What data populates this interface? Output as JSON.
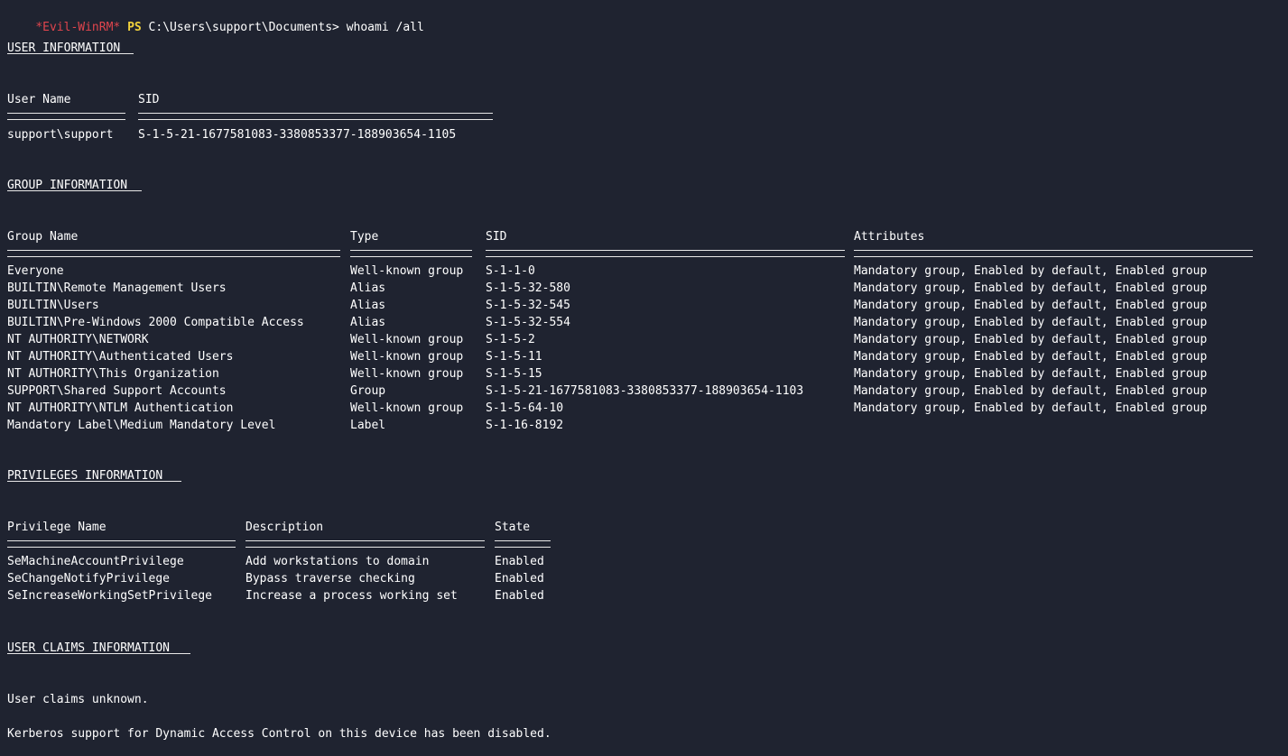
{
  "prompt": {
    "evil": "*Evil-WinRM*",
    "ps": "PS",
    "path": "C:\\Users\\support\\Documents>"
  },
  "command": "whoami /all",
  "user_info": {
    "title": "USER INFORMATION",
    "headers": [
      "User Name",
      "SID"
    ],
    "rows": [
      [
        "support\\support",
        "S-1-5-21-1677581083-3380853377-188903654-1105"
      ]
    ]
  },
  "group_info": {
    "title": "GROUP INFORMATION",
    "headers": [
      "Group Name",
      "Type",
      "SID",
      "Attributes"
    ],
    "rows": [
      [
        "Everyone",
        "Well-known group",
        "S-1-1-0",
        "Mandatory group, Enabled by default, Enabled group"
      ],
      [
        "BUILTIN\\Remote Management Users",
        "Alias",
        "S-1-5-32-580",
        "Mandatory group, Enabled by default, Enabled group"
      ],
      [
        "BUILTIN\\Users",
        "Alias",
        "S-1-5-32-545",
        "Mandatory group, Enabled by default, Enabled group"
      ],
      [
        "BUILTIN\\Pre-Windows 2000 Compatible Access",
        "Alias",
        "S-1-5-32-554",
        "Mandatory group, Enabled by default, Enabled group"
      ],
      [
        "NT AUTHORITY\\NETWORK",
        "Well-known group",
        "S-1-5-2",
        "Mandatory group, Enabled by default, Enabled group"
      ],
      [
        "NT AUTHORITY\\Authenticated Users",
        "Well-known group",
        "S-1-5-11",
        "Mandatory group, Enabled by default, Enabled group"
      ],
      [
        "NT AUTHORITY\\This Organization",
        "Well-known group",
        "S-1-5-15",
        "Mandatory group, Enabled by default, Enabled group"
      ],
      [
        "SUPPORT\\Shared Support Accounts",
        "Group",
        "S-1-5-21-1677581083-3380853377-188903654-1103",
        "Mandatory group, Enabled by default, Enabled group"
      ],
      [
        "NT AUTHORITY\\NTLM Authentication",
        "Well-known group",
        "S-1-5-64-10",
        "Mandatory group, Enabled by default, Enabled group"
      ],
      [
        "Mandatory Label\\Medium Mandatory Level",
        "Label",
        "S-1-16-8192",
        ""
      ]
    ]
  },
  "privileges_info": {
    "title": "PRIVILEGES INFORMATION",
    "headers": [
      "Privilege Name",
      "Description",
      "State"
    ],
    "rows": [
      [
        "SeMachineAccountPrivilege",
        "Add workstations to domain",
        "Enabled"
      ],
      [
        "SeChangeNotifyPrivilege",
        "Bypass traverse checking",
        "Enabled"
      ],
      [
        "SeIncreaseWorkingSetPrivilege",
        "Increase a process working set",
        "Enabled"
      ]
    ]
  },
  "claims_info": {
    "title": "USER CLAIMS INFORMATION",
    "message": "User claims unknown."
  },
  "kerberos_message": "Kerberos support for Dynamic Access Control on this device has been disabled.",
  "colors": {
    "background": "#1f2330",
    "prompt_evil": "#e0454d",
    "prompt_ps": "#f2d23c",
    "text": "#ffffff"
  }
}
